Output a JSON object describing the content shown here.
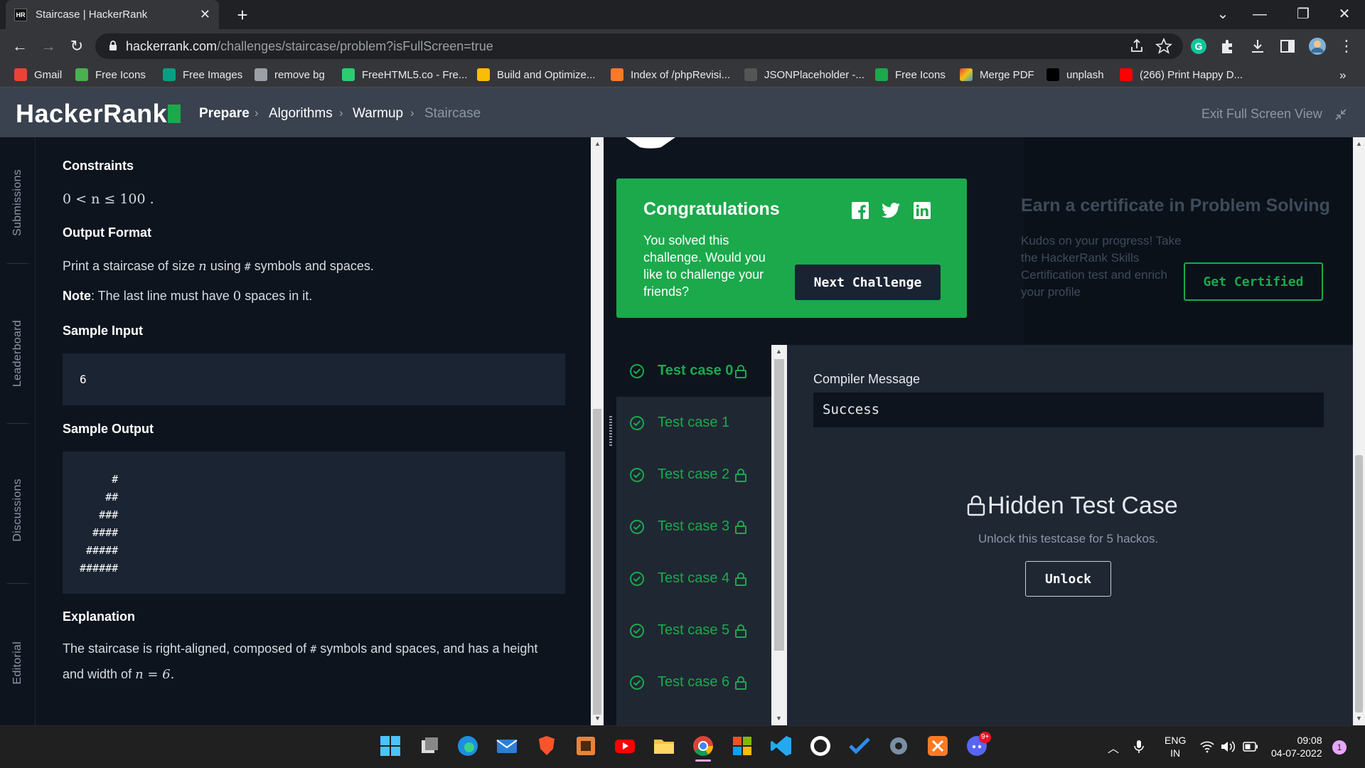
{
  "browser": {
    "tab_title": "Staircase | HackerRank",
    "tab_favicon": "HR",
    "url_host": "hackerrank.com",
    "url_path": "/challenges/staircase/problem?isFullScreen=true",
    "bookmarks": [
      {
        "label": "Gmail",
        "color": "#ea4335"
      },
      {
        "label": "Free Icons",
        "color": "#4caf50"
      },
      {
        "label": "Free Images",
        "color": "#05a081"
      },
      {
        "label": "remove bg",
        "color": "#9aa0a6"
      },
      {
        "label": "FreeHTML5.co - Fre...",
        "color": "#2ecc71"
      },
      {
        "label": "Build and Optimize...",
        "color": "#fbbc04"
      },
      {
        "label": "Index of /phpRevisi...",
        "color": "#fb7a24"
      },
      {
        "label": "JSONPlaceholder -...",
        "color": "#555555"
      },
      {
        "label": "Free Icons",
        "color": "#1ba94c"
      },
      {
        "label": "Merge PDF",
        "color": "#e04040"
      },
      {
        "label": "unplash",
        "color": "#000000"
      },
      {
        "label": "(266) Print Happy D...",
        "color": "#ff0000"
      }
    ]
  },
  "header": {
    "logo": "HackerRank",
    "breadcrumb": [
      "Prepare",
      "Algorithms",
      "Warmup",
      "Staircase"
    ],
    "exit_fullscreen": "Exit Full Screen View"
  },
  "leftnav": [
    "Submissions",
    "Leaderboard",
    "Discussions",
    "Editorial"
  ],
  "problem": {
    "constraints_heading": "Constraints",
    "constraints": "0 < n ≤ 100 .",
    "output_heading": "Output Format",
    "output_text_1": "Print a staircase of size",
    "output_var": "n",
    "output_text_2": "using",
    "output_hash": "#",
    "output_text_3": "symbols and spaces.",
    "note_label": "Note",
    "note_text_1": ": The last line must have",
    "note_zero": "0",
    "note_text_2": "spaces in it.",
    "sample_input_heading": "Sample Input",
    "sample_input": "6",
    "sample_output_heading": "Sample Output",
    "sample_output": [
      "     #",
      "    ##",
      "   ###",
      "  ####",
      " #####",
      "######"
    ],
    "explanation_heading": "Explanation",
    "explanation_1": "The staircase is right-aligned, composed of",
    "explanation_hash": "#",
    "explanation_2": "symbols and spaces, and has a height",
    "explanation_3": "and width of",
    "explanation_eq": "n = 6."
  },
  "congrats": {
    "title": "Congratulations",
    "text": "You solved this challenge. Would you like to challenge your friends?",
    "next_button": "Next Challenge",
    "social": [
      "facebook-icon",
      "twitter-icon",
      "linkedin-icon"
    ]
  },
  "certificate": {
    "title": "Earn a certificate in Problem Solving",
    "text": "Kudos on your progress! Take the HackerRank Skills Certification test and enrich your profile",
    "button": "Get Certified"
  },
  "testcases": [
    {
      "label": "Test case 0",
      "locked": true,
      "selected": true
    },
    {
      "label": "Test case 1",
      "locked": false,
      "selected": false
    },
    {
      "label": "Test case 2",
      "locked": true,
      "selected": false
    },
    {
      "label": "Test case 3",
      "locked": true,
      "selected": false
    },
    {
      "label": "Test case 4",
      "locked": true,
      "selected": false
    },
    {
      "label": "Test case 5",
      "locked": true,
      "selected": false
    },
    {
      "label": "Test case 6",
      "locked": true,
      "selected": false
    }
  ],
  "result": {
    "compiler_label": "Compiler Message",
    "compiler_value": "Success",
    "hidden_title": "Hidden Test Case",
    "hidden_text": "Unlock this testcase for 5 hackos.",
    "unlock_button": "Unlock"
  },
  "taskbar": {
    "lang_1": "ENG",
    "lang_2": "IN",
    "time": "09:08",
    "date": "04-07-2022",
    "notifications": "1",
    "discord_badge": "9+"
  },
  "colors": {
    "brand_green": "#1ba94c",
    "header_bg": "#39424e",
    "page_bg": "#0e141e"
  }
}
